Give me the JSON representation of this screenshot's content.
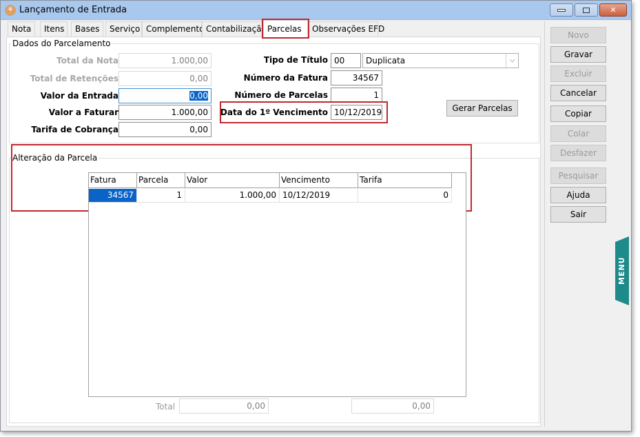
{
  "window": {
    "title": "Lançamento de Entrada",
    "icon": "app-icon",
    "controls": {
      "minimize": "minimize-icon",
      "maximize": "maximize-icon",
      "close": "✕"
    }
  },
  "tabs": [
    {
      "label": "Nota"
    },
    {
      "label": "Itens"
    },
    {
      "label": "Bases"
    },
    {
      "label": "Serviço"
    },
    {
      "label": "Complemento"
    },
    {
      "label": "Contabilização"
    },
    {
      "label": "Parcelas",
      "active": true
    },
    {
      "label": "Observações EFD"
    }
  ],
  "dados": {
    "legend": "Dados do Parcelamento",
    "total_nota": {
      "label": "Total da Nota",
      "value": "1.000,00"
    },
    "total_retencoes": {
      "label": "Total de Retenções",
      "value": "0,00"
    },
    "valor_entrada": {
      "label": "Valor da Entrada",
      "value": "0,00"
    },
    "valor_faturar": {
      "label": "Valor a Faturar",
      "value": "1.000,00"
    },
    "tarifa_cobranca": {
      "label": "Tarifa de Cobrança",
      "value": "0,00"
    },
    "tipo_titulo": {
      "label": "Tipo de Título",
      "code": "00",
      "selected": "Duplicata"
    },
    "numero_fatura": {
      "label": "Número da Fatura",
      "value": "34567"
    },
    "numero_parcelas": {
      "label": "Número de Parcelas",
      "value": "1"
    },
    "data_vencimento": {
      "label": "Data do 1º Vencimento",
      "value": "10/12/2019"
    },
    "gerar_parcelas": "Gerar Parcelas"
  },
  "alteracao": {
    "legend": "Alteração da Parcela",
    "columns": [
      "Fatura",
      "Parcela",
      "Valor",
      "Vencimento",
      "Tarifa"
    ],
    "rows": [
      {
        "fatura": "34567",
        "parcela": "1",
        "valor": "1.000,00",
        "vencimento": "10/12/2019",
        "tarifa": "0"
      }
    ],
    "total_label": "Total",
    "total_valor": "0,00",
    "total_tarifa": "0,00"
  },
  "sidebar": {
    "buttons": [
      {
        "label": "Novo",
        "enabled": false
      },
      {
        "label": "Gravar",
        "enabled": true
      },
      {
        "label": "Excluir",
        "enabled": false
      },
      {
        "label": "Cancelar",
        "enabled": true
      },
      {
        "label": "Copiar",
        "enabled": true
      },
      {
        "label": "Colar",
        "enabled": false
      },
      {
        "label": "Desfazer",
        "enabled": false
      },
      {
        "label": "Pesquisar",
        "enabled": false
      },
      {
        "label": "Ajuda",
        "enabled": true
      },
      {
        "label": "Sair",
        "enabled": true
      }
    ]
  },
  "menu_tab": {
    "label": "MENU",
    "color": "#1e8a8a"
  },
  "colors": {
    "highlight": "#c0272d",
    "selection": "#0a64c8",
    "titlebar": "#a9c8ee"
  }
}
